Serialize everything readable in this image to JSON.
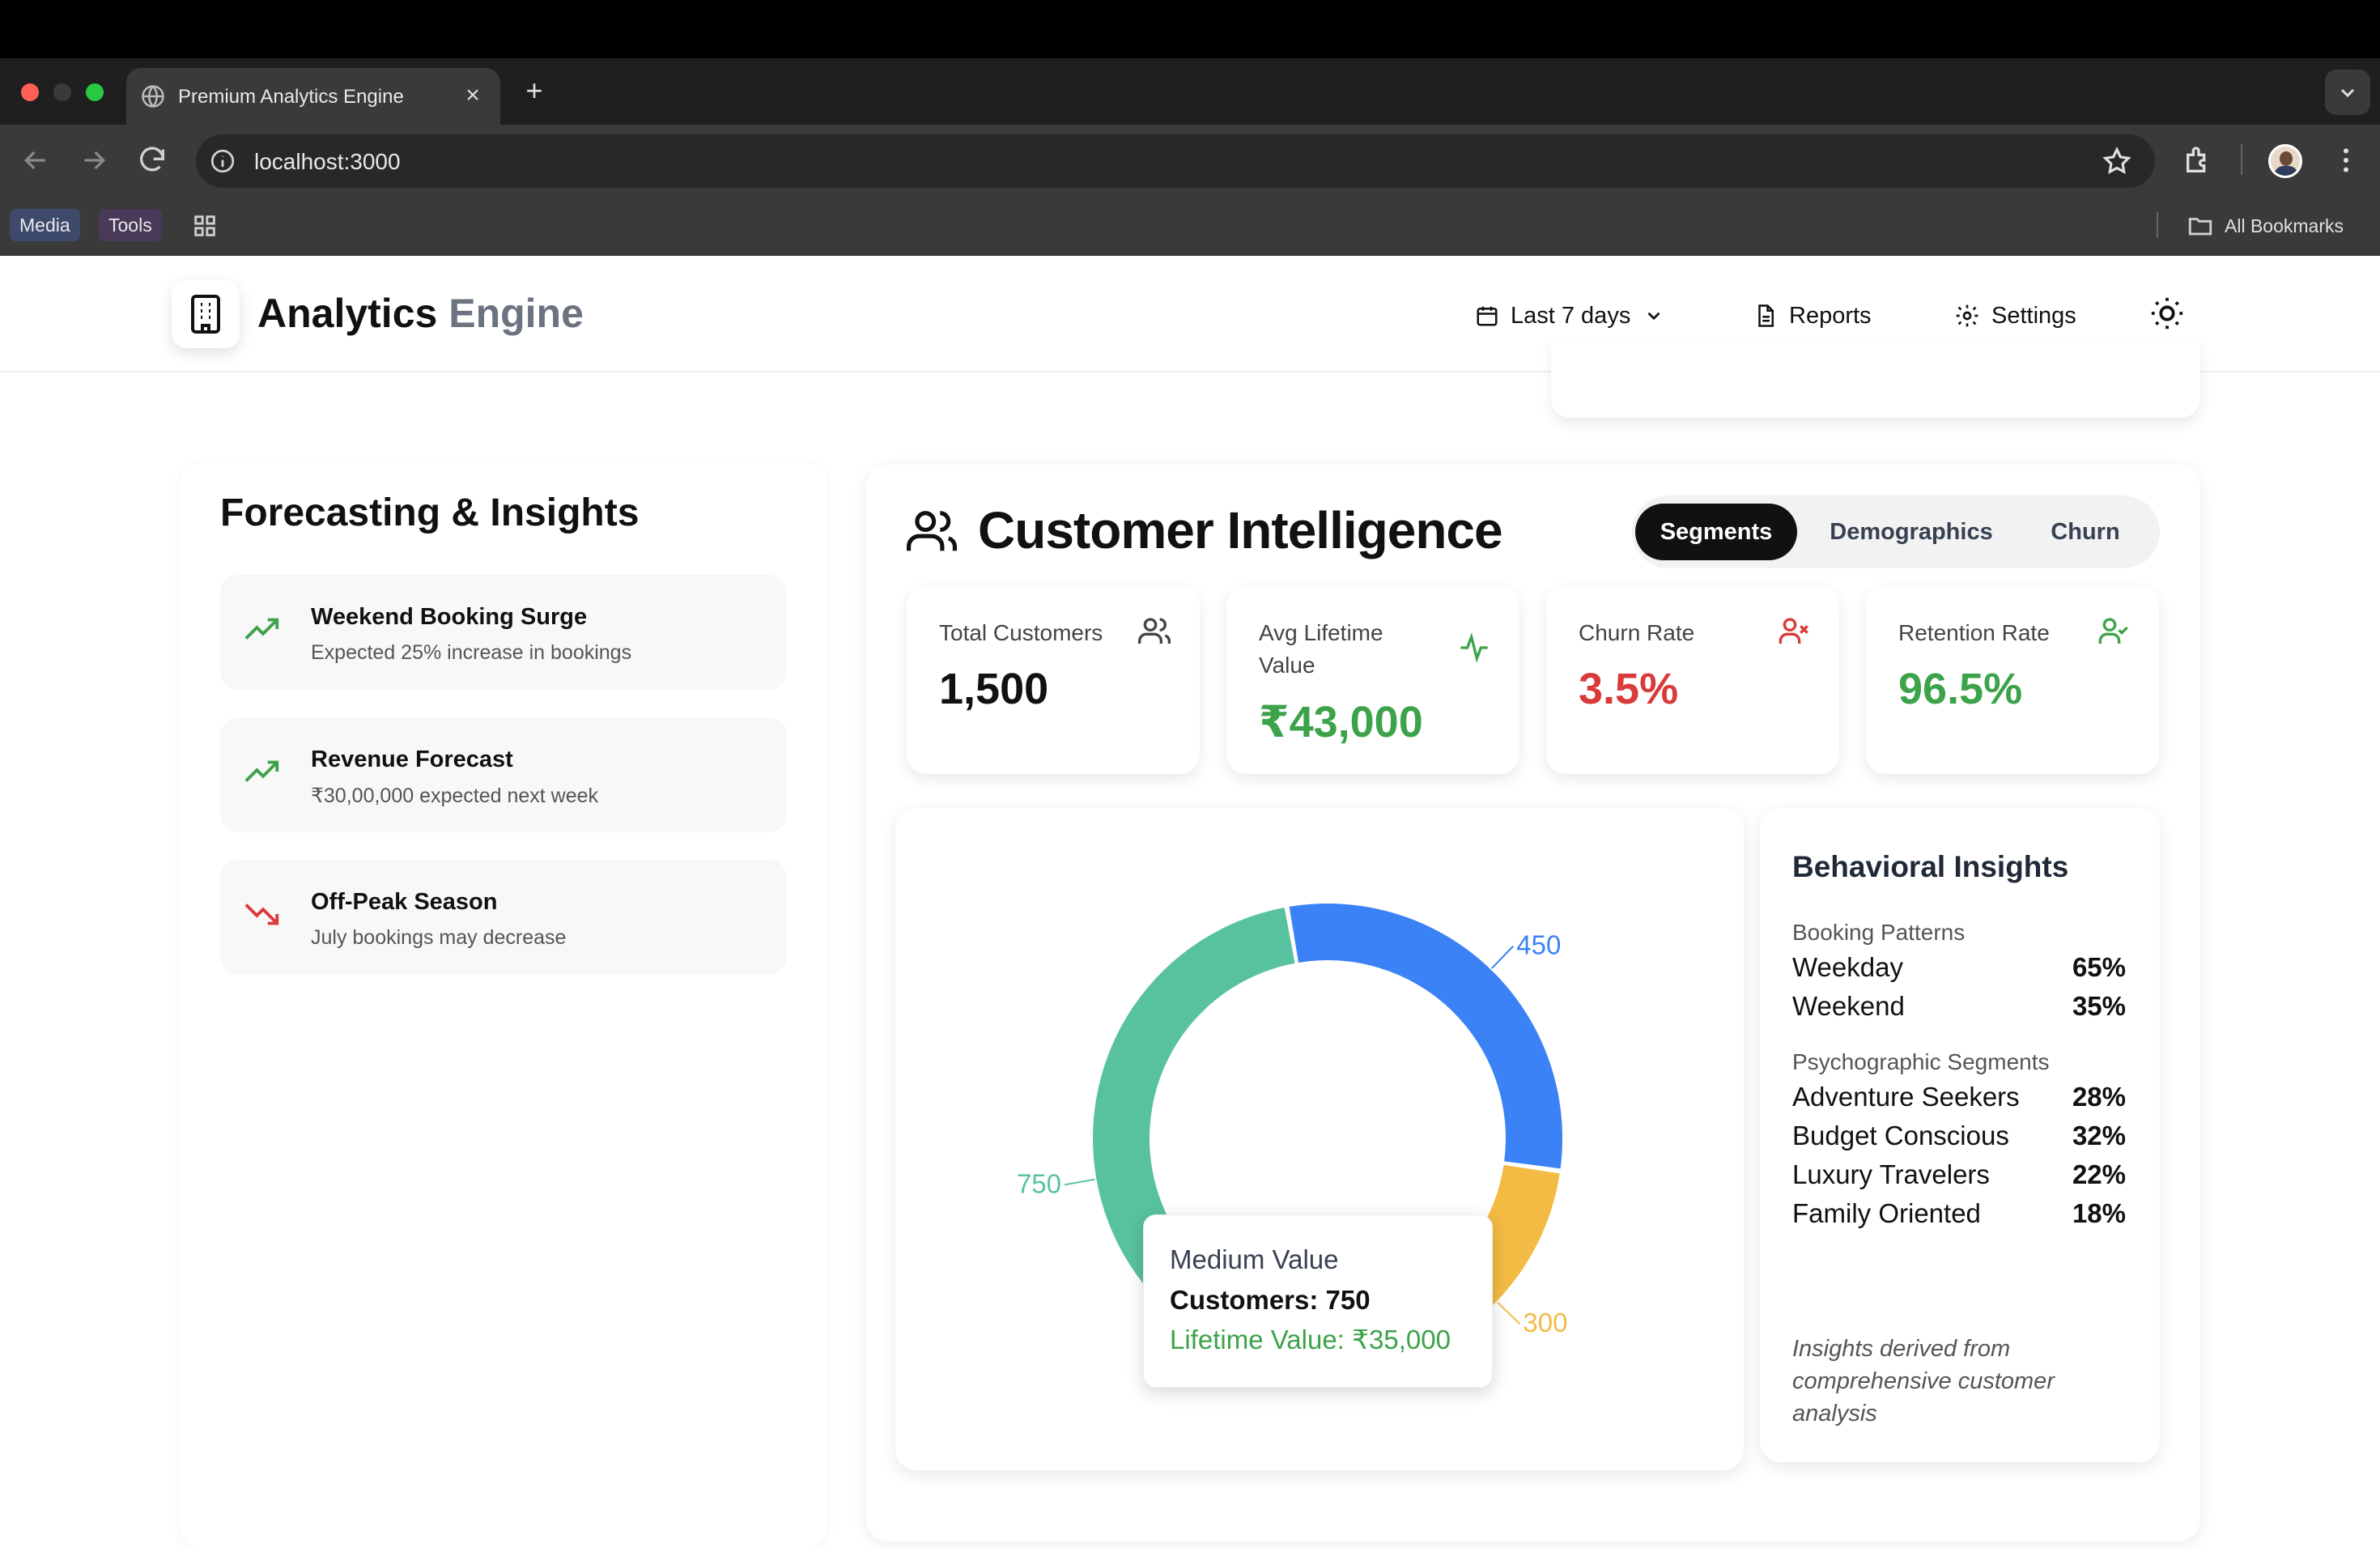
{
  "browser": {
    "tab_title": "Premium Analytics Engine",
    "url": "localhost:3000",
    "bookmarks": [
      "Media",
      "Tools"
    ],
    "all_bookmarks": "All Bookmarks"
  },
  "header": {
    "title_main": "Analytics",
    "title_muted": "Engine",
    "date_range": "Last 7 days",
    "reports": "Reports",
    "settings": "Settings"
  },
  "forecast": {
    "title": "Forecasting & Insights",
    "items": [
      {
        "title": "Weekend Booking Surge",
        "subtitle": "Expected 25% increase in bookings",
        "trend": "up"
      },
      {
        "title": "Revenue Forecast",
        "subtitle": "₹30,00,000 expected next week",
        "trend": "up"
      },
      {
        "title": "Off-Peak Season",
        "subtitle": "July bookings may decrease",
        "trend": "down"
      }
    ]
  },
  "customer": {
    "title": "Customer Intelligence",
    "tabs": [
      "Segments",
      "Demographics",
      "Churn"
    ],
    "kpis": [
      {
        "label": "Total Customers",
        "value": "1,500",
        "color": "#111111"
      },
      {
        "label": "Avg Lifetime Value",
        "value": "₹43,000",
        "color": "#3ca34a"
      },
      {
        "label": "Churn Rate",
        "value": "3.5%",
        "color": "#d93a3a"
      },
      {
        "label": "Retention Rate",
        "value": "96.5%",
        "color": "#3ca34a"
      }
    ]
  },
  "chart_data": {
    "type": "pie",
    "donut": true,
    "slices": [
      {
        "label": "450",
        "value": 450,
        "color": "#3b82f6"
      },
      {
        "label": "300",
        "value": 300,
        "color": "#f4bb44"
      },
      {
        "label": "750",
        "value": 750,
        "color": "#58c2a0"
      }
    ]
  },
  "tooltip": {
    "title": "Medium Value",
    "count": "Customers: 750",
    "ltv": "Lifetime Value: ₹35,000"
  },
  "behavior": {
    "title": "Behavioral Insights",
    "booking_label": "Booking Patterns",
    "booking": [
      {
        "k": "Weekday",
        "v": "65%"
      },
      {
        "k": "Weekend",
        "v": "35%"
      }
    ],
    "psycho_label": "Psychographic Segments",
    "psycho": [
      {
        "k": "Adventure Seekers",
        "v": "28%"
      },
      {
        "k": "Budget Conscious",
        "v": "32%"
      },
      {
        "k": "Luxury Travelers",
        "v": "22%"
      },
      {
        "k": "Family Oriented",
        "v": "18%"
      }
    ],
    "footnote": "Insights derived from comprehensive customer analysis"
  }
}
